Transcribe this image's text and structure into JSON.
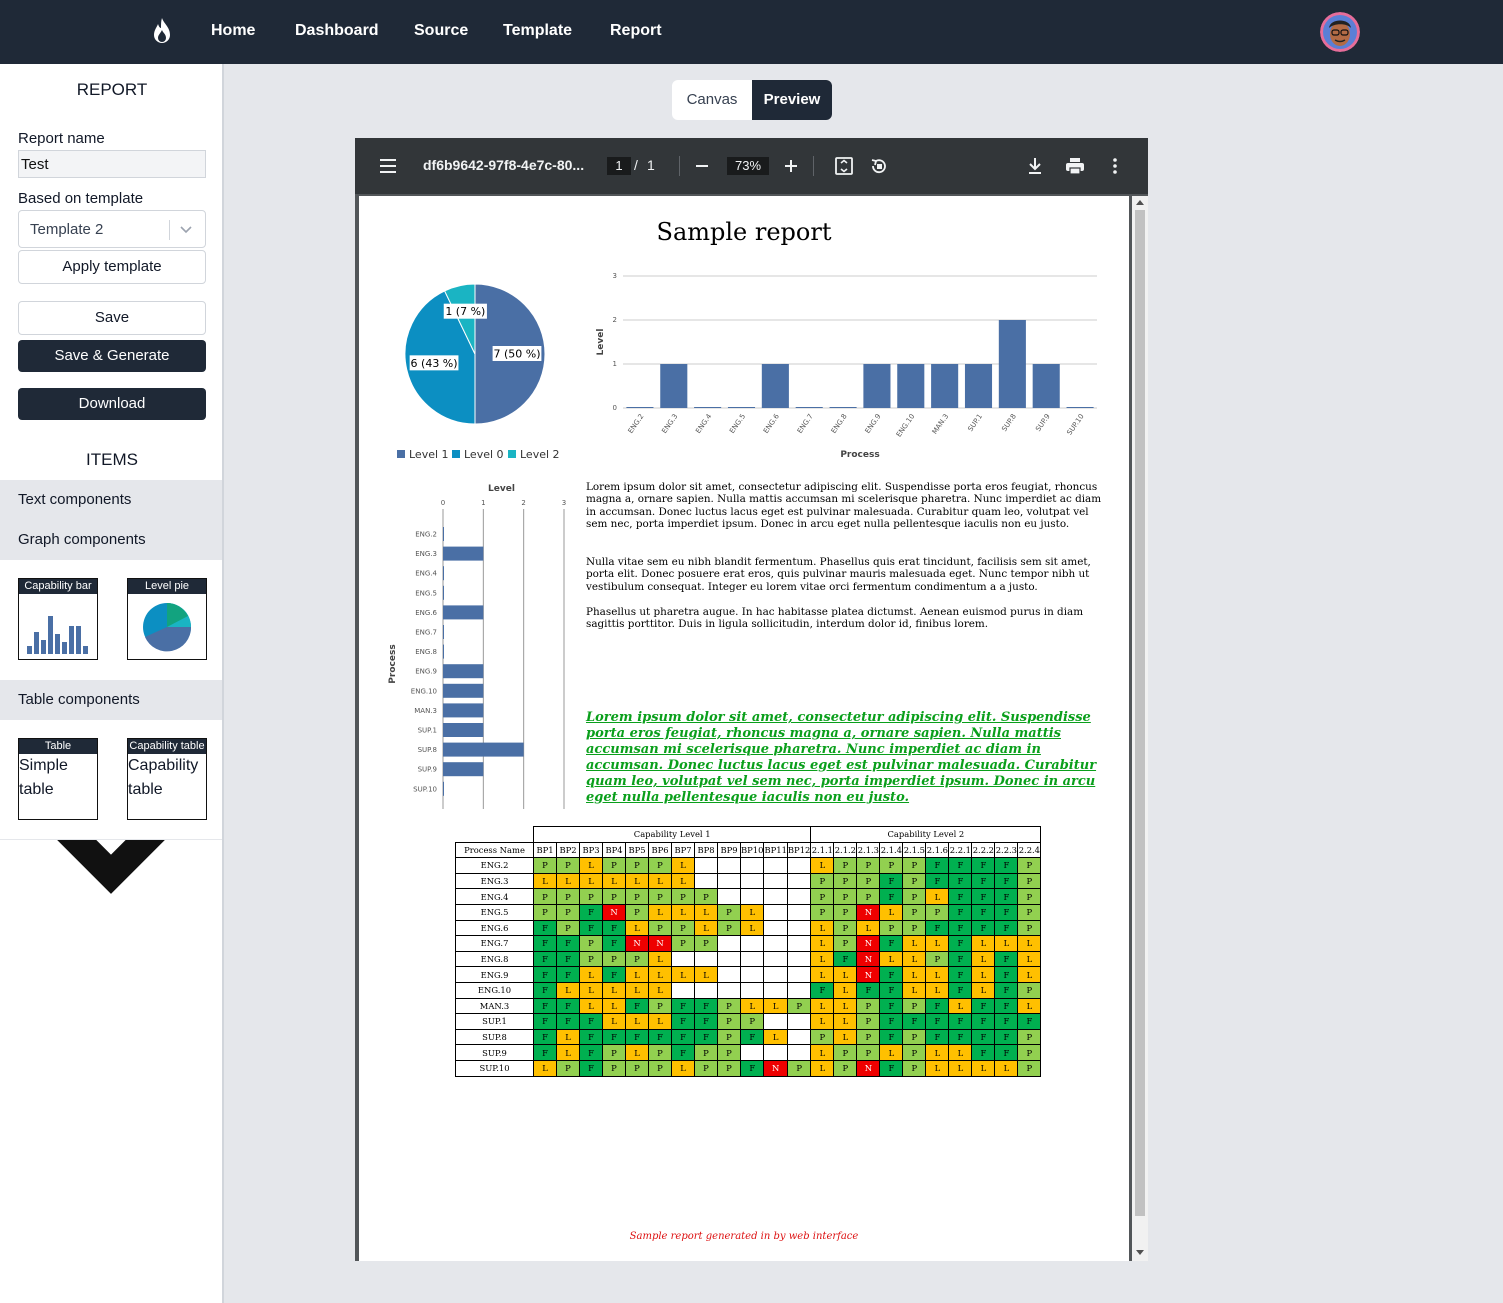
{
  "nav": {
    "links": [
      "Home",
      "Dashboard",
      "Source",
      "Template",
      "Report"
    ]
  },
  "sidebar": {
    "title": "REPORT",
    "report_name_label": "Report name",
    "report_name_value": "Test",
    "template_label": "Based on template",
    "template_value": "Template 2",
    "apply_label": "Apply template",
    "save_label": "Save",
    "save_generate_label": "Save & Generate",
    "download_label": "Download",
    "items_title": "ITEMS",
    "sections": {
      "text": "Text components",
      "graph": "Graph components",
      "table": "Table components"
    },
    "graph_cards": [
      {
        "header": "Capability bar"
      },
      {
        "header": "Level pie"
      }
    ],
    "table_cards": [
      {
        "header": "Table",
        "body": "Simple table"
      },
      {
        "header": "Capability table",
        "body": "Capability table"
      }
    ]
  },
  "view_toggle": {
    "canvas": "Canvas",
    "preview": "Preview"
  },
  "pdf_viewer": {
    "filename": "df6b9642-97f8-4e7c-80...",
    "page_current": "1",
    "page_sep": "/",
    "page_total": "1",
    "zoom": "73%"
  },
  "report": {
    "title": "Sample report",
    "paragraphs": [
      "Lorem ipsum dolor sit amet, consectetur adipiscing elit. Suspendisse porta eros feugiat, rhoncus magna a, ornare sapien. Nulla mattis accumsan mi scelerisque pharetra. Nunc imperdiet ac diam in accumsan. Donec luctus lacus eget est pulvinar malesuada. Curabitur quam leo, volutpat vel sem nec, porta imperdiet ipsum. Donec in arcu eget nulla pellentesque iaculis non eu justo.",
      "Nulla vitae sem eu nibh blandit fermentum. Phasellus quis erat tincidunt, facilisis sem sit amet, porta elit. Donec posuere erat eros, quis pulvinar mauris malesuada eget. Nunc tempor nibh ut vestibulum consequat. Integer eu lorem vitae orci fermentum condimentum a a justo.",
      "Phasellus ut pharetra augue. In hac habitasse platea dictumst. Aenean euismod purus in diam sagittis porttitor. Duis in ligula sollicitudin, interdum dolor id, finibus lorem."
    ],
    "green_paragraph": "Lorem ipsum dolor sit amet, consectetur adipiscing elit. Suspendisse porta eros feugiat, rhoncus magna a, ornare sapien. Nulla mattis accumsan mi scelerisque pharetra. Nunc imperdiet ac diam in accumsan. Donec luctus lacus eget est pulvinar malesuada. Curabitur quam leo, volutpat vel sem nec, porta imperdiet ipsum. Donec in arcu eget nulla pellentesque iaculis non eu justo.",
    "footer": "Sample report generated in by web interface",
    "table": {
      "group1": "Capability Level 1",
      "group2": "Capability Level 2",
      "process_header": "Process Name",
      "columns1": [
        "BP1",
        "BP2",
        "BP3",
        "BP4",
        "BP5",
        "BP6",
        "BP7",
        "BP8",
        "BP9",
        "BP10",
        "BP11",
        "BP12"
      ],
      "columns2": [
        "2.1.1",
        "2.1.2",
        "2.1.3",
        "2.1.4",
        "2.1.5",
        "2.1.6",
        "2.2.1",
        "2.2.2",
        "2.2.3",
        "2.2.4"
      ],
      "rows": [
        {
          "name": "ENG.2",
          "l1": [
            "P",
            "P",
            "L",
            "P",
            "P",
            "P",
            "L",
            "",
            "",
            "",
            "",
            ""
          ],
          "l2": [
            "L",
            "P",
            "P",
            "P",
            "P",
            "F",
            "F",
            "F",
            "F",
            "P"
          ]
        },
        {
          "name": "ENG.3",
          "l1": [
            "L",
            "L",
            "L",
            "L",
            "L",
            "L",
            "L",
            "",
            "",
            "",
            "",
            ""
          ],
          "l2": [
            "P",
            "P",
            "P",
            "F",
            "P",
            "F",
            "F",
            "F",
            "F",
            "P"
          ]
        },
        {
          "name": "ENG.4",
          "l1": [
            "P",
            "P",
            "P",
            "P",
            "P",
            "P",
            "P",
            "P",
            "",
            "",
            "",
            ""
          ],
          "l2": [
            "P",
            "P",
            "P",
            "F",
            "P",
            "L",
            "F",
            "F",
            "F",
            "P"
          ]
        },
        {
          "name": "ENG.5",
          "l1": [
            "P",
            "P",
            "F",
            "N",
            "P",
            "L",
            "L",
            "L",
            "P",
            "L",
            "",
            ""
          ],
          "l2": [
            "P",
            "P",
            "N",
            "L",
            "P",
            "P",
            "F",
            "F",
            "F",
            "P"
          ]
        },
        {
          "name": "ENG.6",
          "l1": [
            "F",
            "P",
            "F",
            "F",
            "L",
            "P",
            "P",
            "L",
            "P",
            "L",
            "",
            ""
          ],
          "l2": [
            "L",
            "P",
            "L",
            "P",
            "P",
            "F",
            "F",
            "F",
            "F",
            "P"
          ]
        },
        {
          "name": "ENG.7",
          "l1": [
            "F",
            "F",
            "P",
            "F",
            "N",
            "N",
            "P",
            "P",
            "",
            "",
            "",
            ""
          ],
          "l2": [
            "L",
            "P",
            "N",
            "F",
            "L",
            "L",
            "F",
            "L",
            "L",
            "L"
          ]
        },
        {
          "name": "ENG.8",
          "l1": [
            "F",
            "F",
            "P",
            "P",
            "P",
            "L",
            "",
            "",
            "",
            "",
            "",
            ""
          ],
          "l2": [
            "L",
            "F",
            "N",
            "L",
            "L",
            "P",
            "F",
            "L",
            "F",
            "L"
          ]
        },
        {
          "name": "ENG.9",
          "l1": [
            "F",
            "F",
            "L",
            "F",
            "L",
            "L",
            "L",
            "L",
            "",
            "",
            "",
            ""
          ],
          "l2": [
            "L",
            "L",
            "N",
            "F",
            "L",
            "L",
            "F",
            "L",
            "F",
            "L"
          ]
        },
        {
          "name": "ENG.10",
          "l1": [
            "F",
            "L",
            "L",
            "L",
            "L",
            "L",
            "",
            "",
            "",
            "",
            "",
            ""
          ],
          "l2": [
            "F",
            "L",
            "F",
            "F",
            "L",
            "L",
            "F",
            "L",
            "F",
            "P"
          ]
        },
        {
          "name": "MAN.3",
          "l1": [
            "F",
            "F",
            "L",
            "L",
            "F",
            "P",
            "F",
            "F",
            "P",
            "L",
            "L",
            "P"
          ],
          "l2": [
            "L",
            "L",
            "P",
            "F",
            "P",
            "F",
            "L",
            "F",
            "F",
            "L"
          ]
        },
        {
          "name": "SUP.1",
          "l1": [
            "F",
            "F",
            "F",
            "L",
            "L",
            "L",
            "F",
            "F",
            "P",
            "P",
            "",
            ""
          ],
          "l2": [
            "L",
            "L",
            "P",
            "F",
            "F",
            "F",
            "F",
            "F",
            "F",
            "F"
          ]
        },
        {
          "name": "SUP.8",
          "l1": [
            "F",
            "L",
            "F",
            "F",
            "F",
            "F",
            "F",
            "F",
            "P",
            "F",
            "L",
            ""
          ],
          "l2": [
            "P",
            "L",
            "P",
            "F",
            "P",
            "F",
            "F",
            "F",
            "F",
            "P"
          ]
        },
        {
          "name": "SUP.9",
          "l1": [
            "F",
            "L",
            "F",
            "P",
            "L",
            "P",
            "F",
            "P",
            "P",
            "",
            "",
            ""
          ],
          "l2": [
            "L",
            "P",
            "P",
            "L",
            "P",
            "L",
            "L",
            "F",
            "F",
            "P"
          ]
        },
        {
          "name": "SUP.10",
          "l1": [
            "L",
            "P",
            "F",
            "P",
            "P",
            "P",
            "L",
            "P",
            "P",
            "F",
            "N",
            "P"
          ],
          "l2": [
            "L",
            "P",
            "N",
            "F",
            "P",
            "L",
            "L",
            "L",
            "L",
            "P"
          ]
        }
      ]
    }
  },
  "chart_data": [
    {
      "type": "pie",
      "slices": [
        {
          "name": "Level 1",
          "value": 7,
          "label": "7 (50 %)",
          "color": "#4a6fa5"
        },
        {
          "name": "Level 0",
          "value": 6,
          "label": "6 (43 %)",
          "color": "#0c8fc2"
        },
        {
          "name": "Level 2",
          "value": 1,
          "label": "1 (7 %)",
          "color": "#1ab4c3"
        }
      ]
    },
    {
      "type": "bar",
      "orientation": "vertical",
      "categories": [
        "ENG.2",
        "ENG.3",
        "ENG.4",
        "ENG.5",
        "ENG.6",
        "ENG.7",
        "ENG.8",
        "ENG.9",
        "ENG.10",
        "MAN.3",
        "SUP.1",
        "SUP.8",
        "SUP.9",
        "SUP.10"
      ],
      "values": [
        0,
        1,
        0,
        0,
        1,
        0,
        0,
        1,
        1,
        1,
        1,
        2,
        1,
        0
      ],
      "xlabel": "Process",
      "ylabel": "Level",
      "ylim": [
        0,
        3
      ],
      "yticks": [
        0,
        1,
        2,
        3
      ],
      "color": "#4a6fa5",
      "grid": true
    },
    {
      "type": "bar",
      "orientation": "horizontal",
      "categories": [
        "ENG.2",
        "ENG.3",
        "ENG.4",
        "ENG.5",
        "ENG.6",
        "ENG.7",
        "ENG.8",
        "ENG.9",
        "ENG.10",
        "MAN.3",
        "SUP.1",
        "SUP.8",
        "SUP.9",
        "SUP.10"
      ],
      "values": [
        0,
        1,
        0,
        0,
        1,
        0,
        0,
        1,
        1,
        1,
        1,
        2,
        1,
        0
      ],
      "xlabel": "Level",
      "ylabel": "Process",
      "xlim": [
        0,
        3
      ],
      "xticks": [
        0,
        1,
        2,
        3
      ],
      "color": "#4a6fa5",
      "grid": true
    }
  ]
}
